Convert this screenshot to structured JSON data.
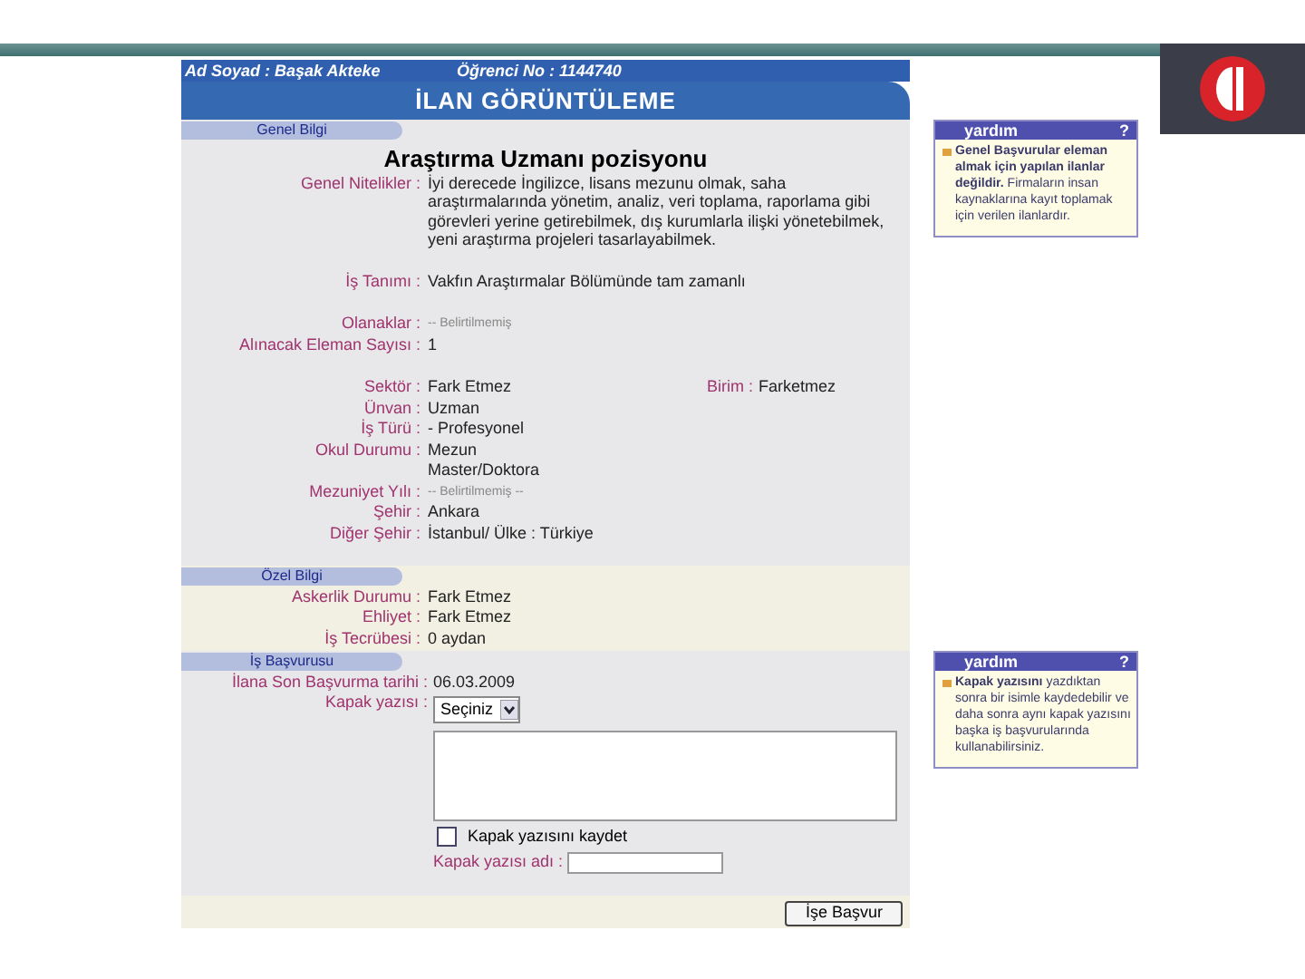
{
  "header": {
    "name_label": "Ad Soyad :",
    "name": "Başak Akteke",
    "number_label": "Öğrenci No :",
    "number": "1144740"
  },
  "title": "İLAN GÖRÜNTÜLEME",
  "general": {
    "tab": "Genel Bilgi",
    "heading": "Araştırma Uzmanı pozisyonu",
    "groups": [
      [
        {
          "label": "Genel Nitelikler :",
          "value": "İyi derecede İngilizce, lisans mezunu olmak, saha araştırmalarında yönetim, analiz, veri toplama, raporlama gibi görevleri yerine getirebilmek, dış kurumlarla ilişki yönetebilmek, yeni araştırma projeleri tasarlayabilmek.",
          "kind": "text"
        }
      ],
      [
        {
          "label": "İş Tanımı :",
          "value": "Vakfın Araştırmalar Bölümünde tam zamanlı",
          "kind": "text"
        }
      ],
      [
        {
          "label": "Olanaklar :",
          "value": "-- Belirtilmemiş",
          "kind": "muted"
        },
        {
          "label": "Alınacak Eleman Sayısı :",
          "value": "1",
          "kind": "text"
        }
      ],
      [
        {
          "label": "Sektör :",
          "value": "Fark Etmez",
          "kind": "text",
          "extra_label": "Birim :",
          "extra_value": "Farketmez"
        },
        {
          "label": "Ünvan :",
          "value": "Uzman",
          "kind": "text"
        },
        {
          "label": "İş Türü :",
          "value": "- Profesyonel",
          "kind": "text"
        },
        {
          "label": "Okul Durumu :",
          "value": [
            "Mezun",
            "Master/Doktora"
          ],
          "kind": "text"
        },
        {
          "label": "Mezuniyet Yılı :",
          "value": "-- Belirtilmemiş --",
          "kind": "muted"
        },
        {
          "label": "Şehir :",
          "value": "Ankara",
          "kind": "text"
        },
        {
          "label": "Diğer Şehir :",
          "value": "İstanbul/ Ülke : Türkiye",
          "kind": "text"
        }
      ]
    ]
  },
  "special": {
    "tab": "Özel Bilgi",
    "fields": [
      {
        "label": "Askerlik Durumu :",
        "value": "Fark Etmez",
        "kind": "text"
      },
      {
        "label": "Ehliyet :",
        "value": "Fark Etmez",
        "kind": "text"
      },
      {
        "label": "İş Tecrübesi :",
        "value": "0 aydan",
        "kind": "text"
      }
    ]
  },
  "application": {
    "tab": "İş Başvurusu",
    "deadline": {
      "label": "İlana Son Başvurma tarihi :",
      "value": "06.03.2009"
    },
    "cover_letter": {
      "label": "Kapak yazısı :",
      "select": "Seçiniz"
    },
    "save": {
      "label": "Kapak yazısını kaydet",
      "checked": false
    },
    "name_field": {
      "label": "Kapak yazısı adı :"
    },
    "submit": "İşe Başvur"
  },
  "help": [
    {
      "title": "yardım",
      "mark": "?",
      "text": "**Genel Başvurular eleman almak için yapılan ilanlar değildir.** Firmaların insan kaynaklarına kayıt toplamak için verilen ilanlardır."
    },
    {
      "title": "yardım",
      "mark": "?",
      "text": "**Kapak yazısını** yazdıktan sonra bir isimle kaydedebilir ve daha sonra aynı kapak yazısını başka iş başvurularında kullanabilirsiniz."
    }
  ]
}
